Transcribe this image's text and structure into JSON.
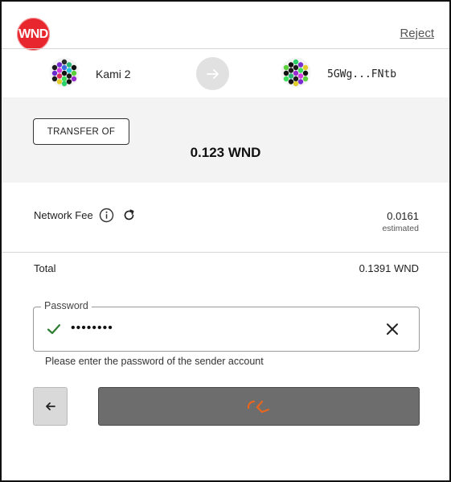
{
  "header": {
    "logo_text": "WND",
    "reject_label": "Reject"
  },
  "sender": {
    "name": "Kami 2",
    "icon": "identicon"
  },
  "recipient": {
    "address": "5GWg...FNtb",
    "icon": "identicon"
  },
  "transfer": {
    "chip_label": "TRANSFER OF",
    "amount": "0.123  WND"
  },
  "fee": {
    "label": "Network Fee",
    "value": "0.0161",
    "sub": "estimated"
  },
  "total": {
    "label": "Total",
    "value": "0.1391 WND"
  },
  "password": {
    "legend": "Password",
    "masked_value": "••••••••",
    "helper": "Please enter the password of the sender account"
  },
  "colors": {
    "brand": "#e8262e",
    "band_bg": "#f3f3f3",
    "button_bg": "#6d6d6d",
    "spinner": "#e8661e",
    "check": "#2e7d32"
  }
}
